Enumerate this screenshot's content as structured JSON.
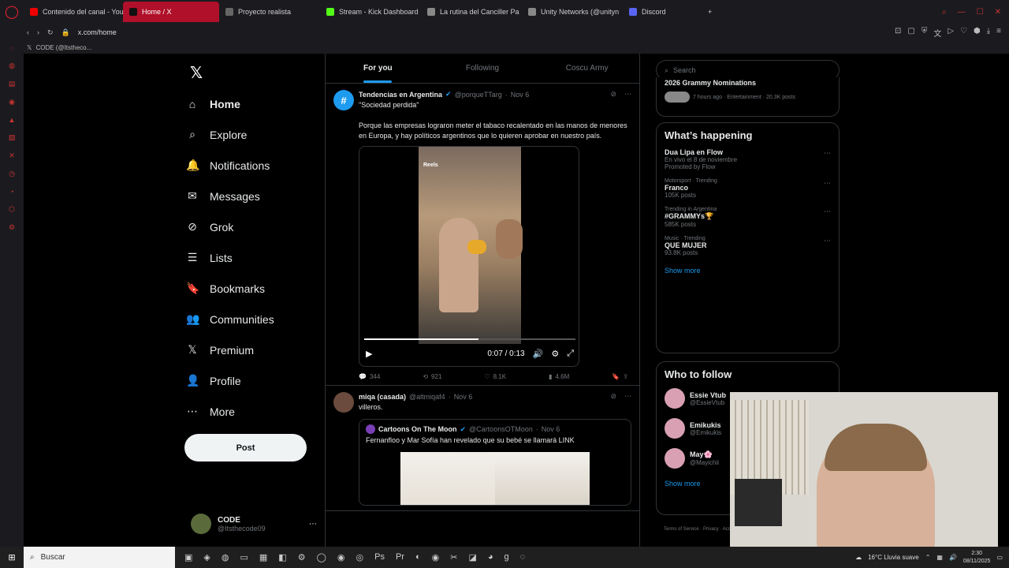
{
  "browser": {
    "tabs": [
      {
        "label": "Contenido del canal - You",
        "color": "#e00",
        "active": false
      },
      {
        "label": "Home / X",
        "color": "#111",
        "active": true
      },
      {
        "label": "Proyecto realista",
        "color": "#666",
        "active": false
      },
      {
        "label": "Stream - Kick Dashboard",
        "color": "#53fc18",
        "active": false
      },
      {
        "label": "La rutina del Canciller Pa",
        "color": "#888",
        "active": false
      },
      {
        "label": "Unity Networks (@unityn",
        "color": "#888",
        "active": false
      },
      {
        "label": "Discord",
        "color": "#5865f2",
        "active": false
      }
    ],
    "url": "x.com/home",
    "page_tab_label": "CODE (@Itstheco..."
  },
  "x": {
    "nav": [
      {
        "label": "Home",
        "icon": "home-icon",
        "glyph": "⌂",
        "active": true
      },
      {
        "label": "Explore",
        "icon": "search-icon",
        "glyph": "⌕"
      },
      {
        "label": "Notifications",
        "icon": "bell-icon",
        "glyph": "🔔"
      },
      {
        "label": "Messages",
        "icon": "mail-icon",
        "glyph": "✉"
      },
      {
        "label": "Grok",
        "icon": "grok-icon",
        "glyph": "⊘"
      },
      {
        "label": "Lists",
        "icon": "list-icon",
        "glyph": "☰"
      },
      {
        "label": "Bookmarks",
        "icon": "bookmark-icon",
        "glyph": "🔖"
      },
      {
        "label": "Communities",
        "icon": "communities-icon",
        "glyph": "👥"
      },
      {
        "label": "Premium",
        "icon": "x-premium-icon",
        "glyph": "𝕏"
      },
      {
        "label": "Profile",
        "icon": "person-icon",
        "glyph": "👤"
      },
      {
        "label": "More",
        "icon": "more-circle-icon",
        "glyph": "⋯"
      }
    ],
    "post_button": "Post",
    "account": {
      "name": "CODE",
      "handle": "@Itsthecode09"
    },
    "timeline_tabs": [
      "For you",
      "Following",
      "Coscu Army"
    ],
    "tweets": [
      {
        "name": "Tendencias en Argentina",
        "handle": "@porqueTTarg",
        "date": "Nov 6",
        "text": "\"Sociedad perdida\"\n\nPorque las empresas lograron meter el tabaco recalentado en las manos de menores en Europa, y hay políticos argentinos que lo quieren aprobar en nuestro país.",
        "video": {
          "overlay_label": "Reels",
          "time": "0:07 / 0:13",
          "progress": 0.54
        },
        "replies": "344",
        "reposts": "921",
        "likes": "8.1K",
        "views": "4.6M"
      },
      {
        "name": "miqa (casada)",
        "handle": "@altmiqaf4",
        "date": "Nov 6",
        "text": "villeros.",
        "quote": {
          "name": "Cartoons On The Moon",
          "handle": "@CartoonsOTMoon",
          "date": "Nov 6",
          "text": "Fernanfloo y Mar Sofía han revelado que su bebé se llamará LINK"
        }
      }
    ],
    "search_placeholder": "Search",
    "grammy_partial": {
      "title": "2026 Grammy Nominations",
      "meta": "7 hours ago · Entertainment · 20.3K posts"
    },
    "whats_happening": {
      "title": "What’s happening",
      "trends": [
        {
          "ctx": "",
          "title": "Dua Lipa en Flow",
          "sub": "En vivo el 8 de noviembre",
          "promo": "Promoted by Flow"
        },
        {
          "ctx": "Motorsport · Trending",
          "title": "Franco",
          "sub": "105K posts"
        },
        {
          "ctx": "Trending in Argentina",
          "title": "#GRAMMYs🏆",
          "sub": "585K posts"
        },
        {
          "ctx": "Music · Trending",
          "title": "QUE MUJER",
          "sub": "93.8K posts"
        }
      ],
      "show_more": "Show more"
    },
    "who_to_follow": {
      "title": "Who to follow",
      "accounts": [
        {
          "name": "Essie Vtub",
          "handle": "@EssieVtub"
        },
        {
          "name": "Emikukis",
          "handle": "@Emikukis"
        },
        {
          "name": "May🌸",
          "handle": "@Mayichii"
        }
      ],
      "show_more": "Show more"
    },
    "footer": "Terms of Service · Privacy · Accessibility · Ads info · More · © 2"
  },
  "taskbar": {
    "search_placeholder": "Buscar",
    "weather": "16°C  Lluvia suave",
    "time": "2:30",
    "date": "08/11/2025"
  }
}
